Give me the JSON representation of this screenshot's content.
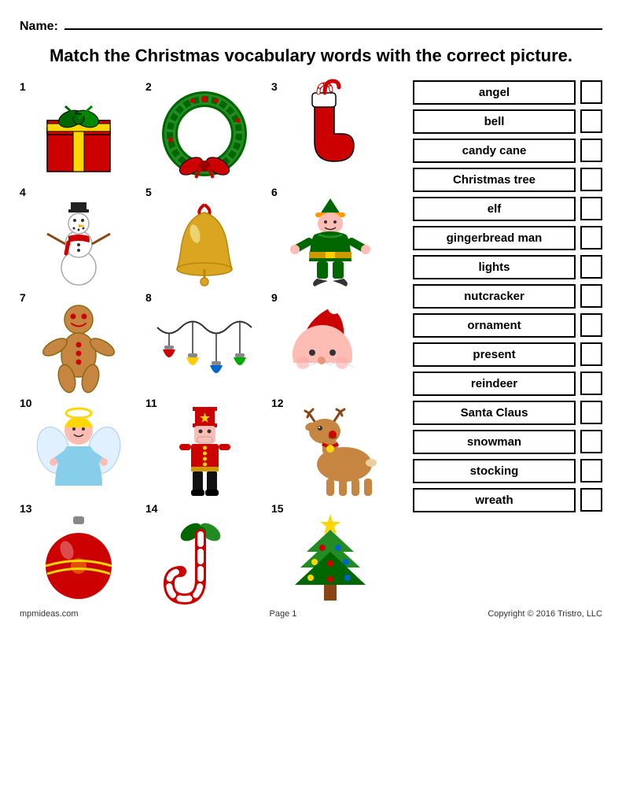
{
  "header": {
    "name_label": "Name:",
    "title": "Match the Christmas vocabulary words with the correct picture."
  },
  "pictures": [
    {
      "number": "1",
      "label": "present"
    },
    {
      "number": "2",
      "label": "wreath"
    },
    {
      "number": "3",
      "label": "stocking"
    },
    {
      "number": "4",
      "label": "snowman"
    },
    {
      "number": "5",
      "label": "bell"
    },
    {
      "number": "6",
      "label": "elf"
    },
    {
      "number": "7",
      "label": "gingerbread man"
    },
    {
      "number": "8",
      "label": "lights"
    },
    {
      "number": "9",
      "label": "Santa Claus"
    },
    {
      "number": "10",
      "label": "angel"
    },
    {
      "number": "11",
      "label": "nutcracker"
    },
    {
      "number": "12",
      "label": "reindeer"
    },
    {
      "number": "13",
      "label": "ornament"
    },
    {
      "number": "14",
      "label": "candy cane"
    },
    {
      "number": "15",
      "label": "Christmas tree"
    }
  ],
  "words": [
    "angel",
    "bell",
    "candy cane",
    "Christmas tree",
    "elf",
    "gingerbread man",
    "lights",
    "nutcracker",
    "ornament",
    "present",
    "reindeer",
    "Santa Claus",
    "snowman",
    "stocking",
    "wreath"
  ],
  "footer": {
    "left": "mpmideas.com",
    "center": "Page 1",
    "right": "Copyright © 2016 Tristro, LLC"
  }
}
